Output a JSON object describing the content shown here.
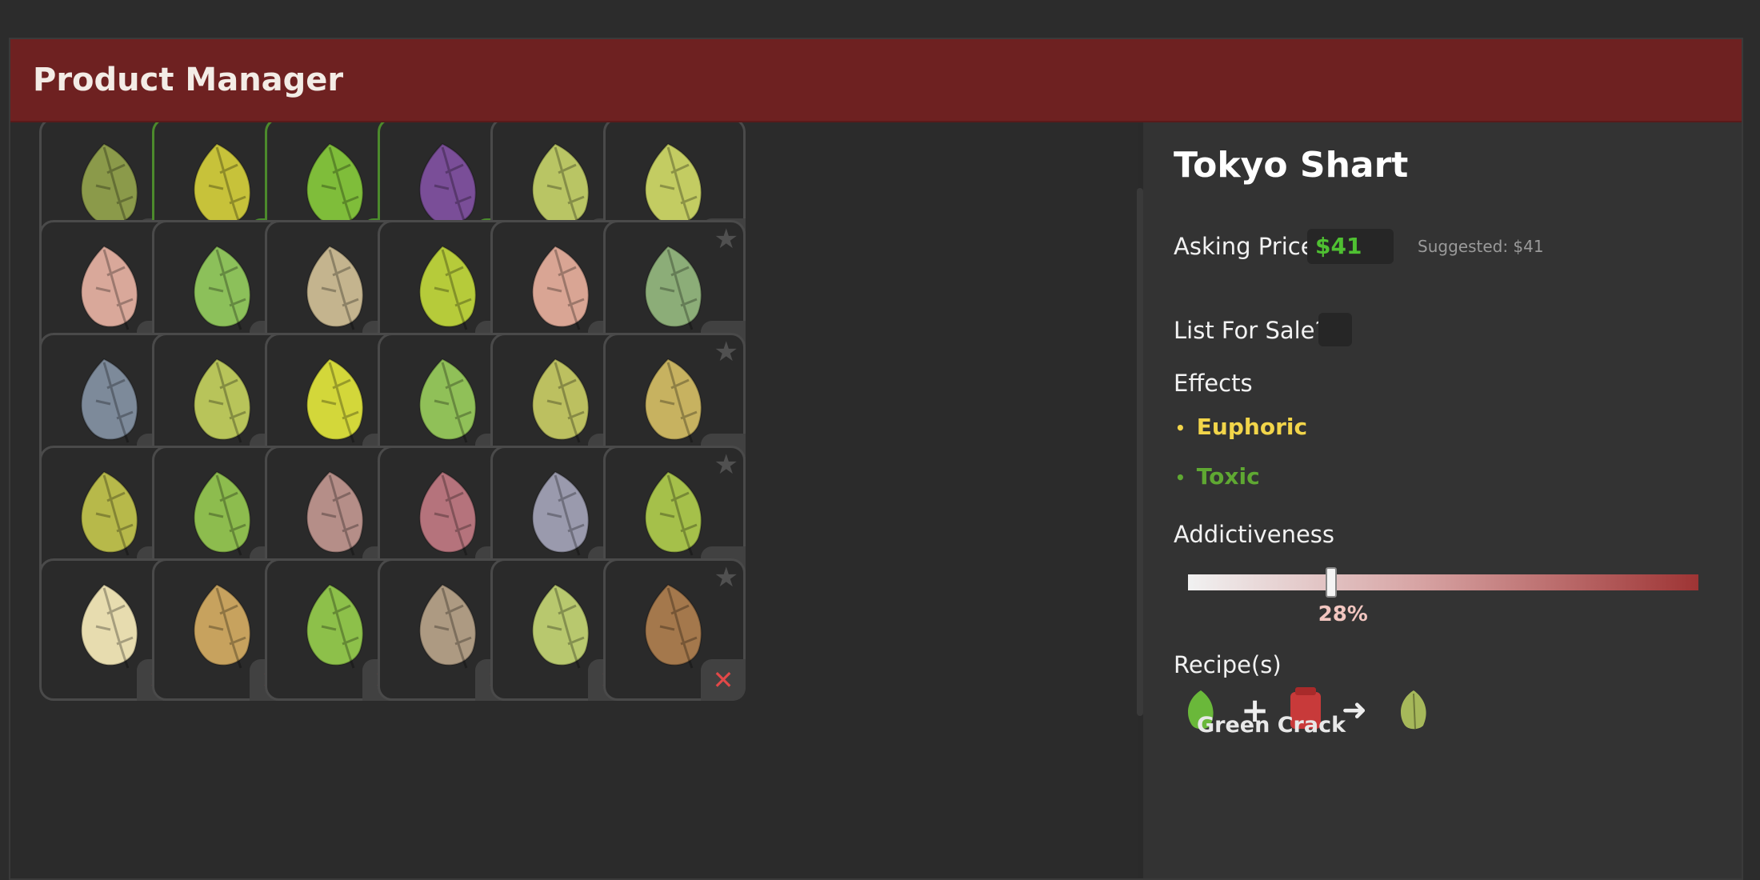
{
  "window": {
    "title": "Product Manager"
  },
  "grid": {
    "remove_glyph": "✕",
    "sale_glyph": "$",
    "star_glyph": "★",
    "rows": [
      [
        {
          "color": "#8b9a4a",
          "state": "remove",
          "star": false
        },
        {
          "color": "#c7c23a",
          "state": "sale",
          "star": false
        },
        {
          "color": "#7fbd3a",
          "state": "sale",
          "star": false
        },
        {
          "color": "#7a4e98",
          "state": "sale",
          "star": false
        },
        {
          "color": "#b9c564",
          "state": "remove",
          "star": false
        },
        {
          "color": "#c3cc62",
          "state": "remove",
          "star": false
        }
      ],
      [
        {
          "color": "#d9a89a",
          "state": "remove",
          "star": true
        },
        {
          "color": "#8cc05a",
          "state": "remove",
          "star": true
        },
        {
          "color": "#c4b48e",
          "state": "remove",
          "star": true
        },
        {
          "color": "#b6cb3a",
          "state": "remove",
          "star": true
        },
        {
          "color": "#d9a594",
          "state": "remove",
          "star": true
        },
        {
          "color": "#8cad78",
          "state": "remove",
          "star": true
        }
      ],
      [
        {
          "color": "#7d8a9a",
          "state": "remove",
          "star": true
        },
        {
          "color": "#b8c45a",
          "state": "remove",
          "star": true
        },
        {
          "color": "#d3d73a",
          "state": "remove",
          "star": true
        },
        {
          "color": "#90c058",
          "state": "remove",
          "star": true
        },
        {
          "color": "#bcc060",
          "state": "remove",
          "star": true
        },
        {
          "color": "#c7b260",
          "state": "remove",
          "star": true
        }
      ],
      [
        {
          "color": "#b7b94a",
          "state": "remove",
          "star": true
        },
        {
          "color": "#8dbc4e",
          "state": "remove",
          "star": true
        },
        {
          "color": "#b58e88",
          "state": "remove",
          "star": true
        },
        {
          "color": "#b5737c",
          "state": "remove",
          "star": true
        },
        {
          "color": "#9a9aad",
          "state": "remove",
          "star": true
        },
        {
          "color": "#a5c04a",
          "state": "remove",
          "star": true
        }
      ],
      [
        {
          "color": "#e7dcaf",
          "state": "remove",
          "star": true
        },
        {
          "color": "#c7a25e",
          "state": "remove",
          "star": true
        },
        {
          "color": "#8dc04a",
          "state": "remove",
          "star": true
        },
        {
          "color": "#ad9a82",
          "state": "remove",
          "star": true
        },
        {
          "color": "#b8c86e",
          "state": "remove",
          "star": true
        },
        {
          "color": "#a4784c",
          "state": "remove",
          "star": true
        }
      ]
    ]
  },
  "details": {
    "product_name": "Tokyo Shart",
    "asking_price_label": "Asking Price",
    "asking_price_value": "$41",
    "suggested_text": "Suggested: $41",
    "list_for_sale_label": "List For Sale?",
    "list_for_sale_checked": false,
    "effects_label": "Effects",
    "effects": [
      {
        "name": "Euphoric",
        "color": "#f2d54a"
      },
      {
        "name": "Toxic",
        "color": "#5fa832"
      }
    ],
    "addictiveness_label": "Addictiveness",
    "addictiveness_value": 0.28,
    "addictiveness_text": "28%",
    "recipes_label": "Recipe(s)",
    "recipe": {
      "ingredient_a_color": "#6ab83a",
      "ingredient_b_color": "#c83a3a",
      "result_color": "#a6b85a",
      "plus": "+",
      "arrow": "➜",
      "caption": "Green Crack"
    }
  }
}
